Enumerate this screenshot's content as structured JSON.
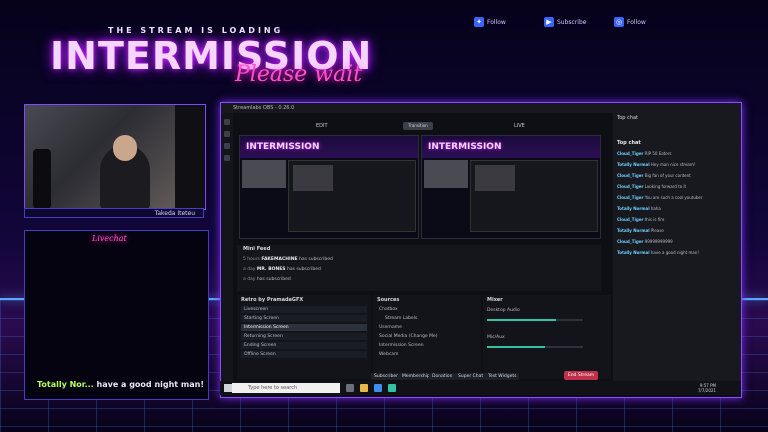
{
  "overlay": {
    "tagline": "THE STREAM IS LOADING",
    "title": "INTERMISSION",
    "subtitle": "Please wait",
    "social": [
      {
        "icon": "twitter-icon",
        "label": "Follow"
      },
      {
        "icon": "youtube-icon",
        "label": "Subscribe"
      },
      {
        "icon": "instagram-icon",
        "label": "Follow"
      }
    ],
    "streamer_name": "Takeda Iteteu",
    "livechat_title": "Livechat",
    "livechat_message": {
      "user": "Totally Nor...",
      "text": " have a good night man!"
    }
  },
  "app": {
    "window_title": "Streamlabs OBS - 0.26.0",
    "edit_label": "EDIT",
    "live_label": "LIVE",
    "transition_label": "Transition",
    "mini_feed": {
      "title": "Mini Feed",
      "rows": [
        {
          "time": "5 hours",
          "name": "FAKEMACHINE",
          "action": "has subscribed"
        },
        {
          "time": "a day",
          "name": "MR. BONES",
          "action": "has subscribed"
        },
        {
          "time": "a day",
          "name": "",
          "action": "has subscribed"
        }
      ]
    },
    "scenes": {
      "title": "Retro by PramadaGFX",
      "items": [
        "Livescreen",
        "Starting Screen",
        "Intermission Screen",
        "Returning Screen",
        "Ending Screen",
        "Offline Screen"
      ],
      "selected": 2
    },
    "sources": {
      "title": "Sources",
      "items": [
        "Chatbox",
        "Stream Labels",
        "Username",
        "Social Media (Change Me)",
        "Intermission Screen",
        "Webcam"
      ]
    },
    "mixer": {
      "title": "Mixer",
      "channels": [
        {
          "name": "Desktop Audio",
          "level": 0.72
        },
        {
          "name": "Mic/Aux",
          "level": 0.6
        }
      ]
    },
    "bottom_buttons": [
      "Subscriber",
      "Membership",
      "Donation",
      "Super Chat",
      "Test Widgets"
    ],
    "go_live": "End Stream",
    "chat": {
      "header": "Top chat",
      "title": "Top chat",
      "messages": [
        {
          "name": "Cloud_Tiger",
          "text": "RIP 50 Eaters"
        },
        {
          "name": "Totally Normal",
          "text": "Hey man nice stream!"
        },
        {
          "name": "Cloud_Tiger",
          "text": "Big fan of your content"
        },
        {
          "name": "Cloud_Tiger",
          "text": "Looking forward to it"
        },
        {
          "name": "Cloud_Tiger",
          "text": "You are such a cool youtuber"
        },
        {
          "name": "Totally Normal",
          "text": "haha"
        },
        {
          "name": "Cloud_Tiger",
          "text": "this is fire"
        },
        {
          "name": "Totally Normal",
          "text": "Please"
        },
        {
          "name": "Cloud_Tiger",
          "text": "99999999999"
        },
        {
          "name": "Totally Normal",
          "text": "have a good night man!"
        }
      ]
    }
  },
  "taskbar": {
    "search_placeholder": "Type here to search",
    "time": "9:57 PM",
    "date": "7/7/2021"
  }
}
